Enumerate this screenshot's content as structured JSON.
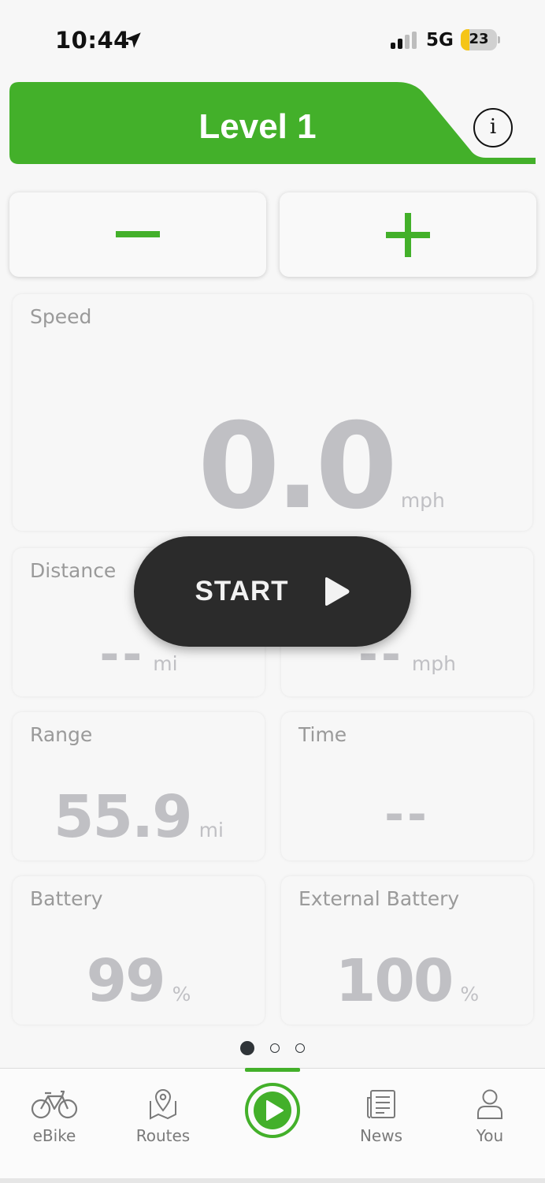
{
  "status_bar": {
    "time": "10:44",
    "network": "5G",
    "battery": "23",
    "battery_fraction": 0.23,
    "battery_fill_color": "#f5c518"
  },
  "level": {
    "title": "Level 1",
    "info_label": "i",
    "accent_color": "#43b02a",
    "decrease_icon": "minus-icon",
    "increase_icon": "plus-icon"
  },
  "metrics": {
    "speed": {
      "label": "Speed",
      "value": "0.0",
      "unit": "mph"
    },
    "distance": {
      "label": "Distance",
      "value": "--",
      "unit": "mi"
    },
    "average": {
      "value": "--",
      "unit": "mph"
    },
    "range": {
      "label": "Range",
      "value": "55.9",
      "unit": "mi"
    },
    "time": {
      "label": "Time",
      "value": "--"
    },
    "battery": {
      "label": "Battery",
      "value": "99",
      "unit": "%"
    },
    "external_battery": {
      "label": "External Battery",
      "value": "100",
      "unit": "%"
    }
  },
  "start_button": {
    "label": "START",
    "icon": "play-icon"
  },
  "pager": {
    "pages": 3,
    "active": 0
  },
  "tabs": [
    {
      "label": "eBike",
      "icon": "bike-icon"
    },
    {
      "label": "Routes",
      "icon": "map-pin-icon"
    },
    {
      "label": "",
      "icon": "play-circle-icon"
    },
    {
      "label": "News",
      "icon": "newspaper-icon"
    },
    {
      "label": "You",
      "icon": "user-icon"
    }
  ]
}
